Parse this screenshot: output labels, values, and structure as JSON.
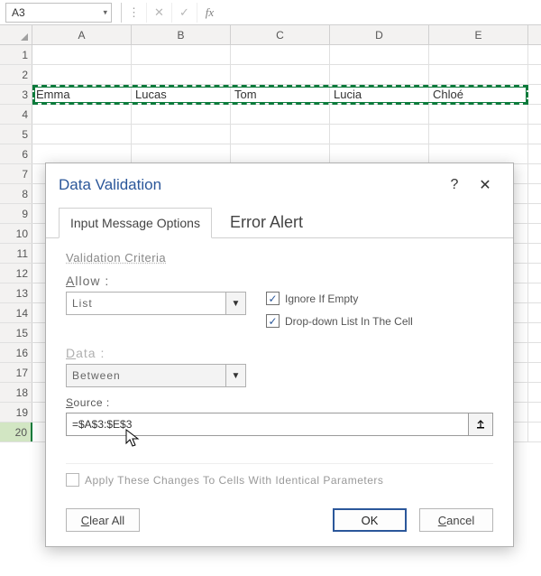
{
  "formula_bar": {
    "name_box": "A3",
    "fx_label": "fx"
  },
  "grid": {
    "columns": [
      "A",
      "B",
      "C",
      "D",
      "E"
    ],
    "rows": [
      "1",
      "2",
      "3",
      "4",
      "5",
      "6",
      "7",
      "8",
      "9",
      "10",
      "11",
      "12",
      "13",
      "14",
      "15",
      "16",
      "17",
      "18",
      "19",
      "20"
    ],
    "row3": {
      "A": "Emma",
      "B": "Lucas",
      "C": "Tom",
      "D": "Lucia",
      "E": "Chloé"
    }
  },
  "dialog": {
    "title": "Data Validation",
    "help": "?",
    "close": "✕",
    "tab1": "Input Message Options",
    "tab2": "Error Alert",
    "criteria_title": "Validation Criteria",
    "allow_label": "Allow :",
    "allow_value": "List",
    "data_label": "Data :",
    "data_value": "Between",
    "ignore_empty_label": "Ignore If Empty",
    "dropdown_label": "Drop-down List In The Cell",
    "source_label": "Source :",
    "source_value": "=$A$3:$E$3",
    "apply_label": "Apply These Changes To Cells With Identical Parameters",
    "clear_label": "Clear All",
    "ok_label": "OK",
    "cancel_label": "Cancel"
  }
}
